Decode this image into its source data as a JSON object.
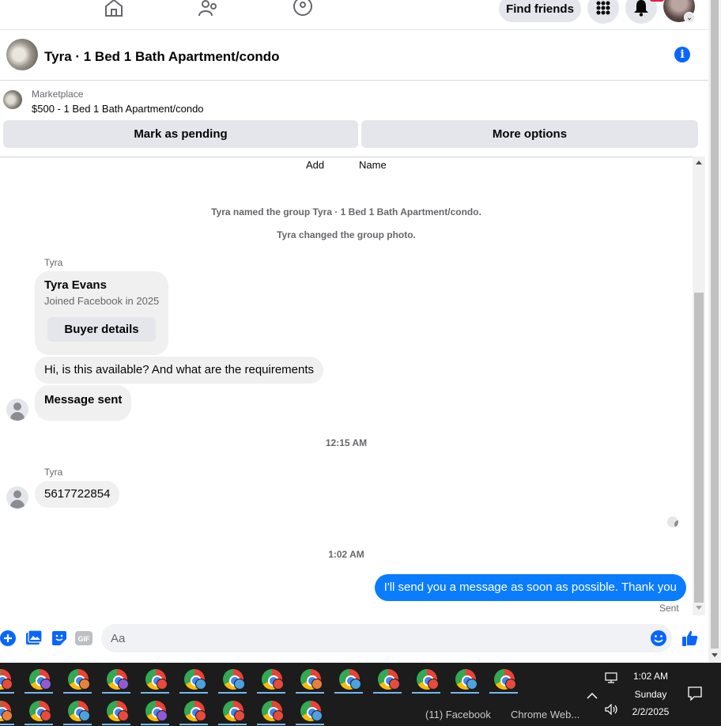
{
  "nav": {
    "find_friends": "Find friends"
  },
  "header": {
    "title": "Tyra · 1 Bed 1 Bath Apartment/condo"
  },
  "marketplace": {
    "label": "Marketplace",
    "listing": "$500 - 1 Bed 1 Bath Apartment/condo",
    "mark_pending": "Mark as pending",
    "more_options": "More options"
  },
  "chat": {
    "top_actions": [
      "Add",
      "Name"
    ],
    "system_messages": [
      "Tyra named the group Tyra · 1 Bed 1 Bath Apartment/condo.",
      "Tyra changed the group photo."
    ],
    "sender1": "Tyra",
    "card": {
      "name": "Tyra Evans",
      "joined": "Joined Facebook in 2025",
      "button": "Buyer details"
    },
    "msg1": "Hi, is this available? And what are the requirements",
    "msg2": "Message sent",
    "time1": "12:15 AM",
    "sender2": "Tyra",
    "msg3": "5617722854",
    "time2": "1:02 AM",
    "outgoing": "I'll send you a message as soon as possible. Thank you",
    "status": "Sent"
  },
  "composer": {
    "placeholder": "Aa"
  },
  "taskbar": {
    "label_facebook": "(11) Facebook",
    "label_chrome": "Chrome Web...",
    "time": "1:02 AM",
    "day": "Sunday",
    "date": "2/2/2025",
    "profile_colors_row1": [
      "#e84a3c",
      "#8e5bd6",
      "#e8803c",
      "#8e5bd6",
      "#e84a3c",
      "#4aa3df",
      "#4aa3df",
      "#e84a3c",
      "#e8803c",
      "#4aa3df",
      "#e84a3c",
      "#e84a3c",
      "#4aa3df",
      "#e84a3c"
    ],
    "profile_colors_row2": [
      "#e8803c",
      "#e84a3c",
      "#4aa3df",
      "#e84a3c",
      "#8e5bd6",
      "#e84a3c",
      "#e84a3c",
      "#e84a3c",
      "#4aa3df"
    ]
  },
  "colors": {
    "accent": "#0866ff",
    "outgoing_bubble": "#0a7cff"
  }
}
